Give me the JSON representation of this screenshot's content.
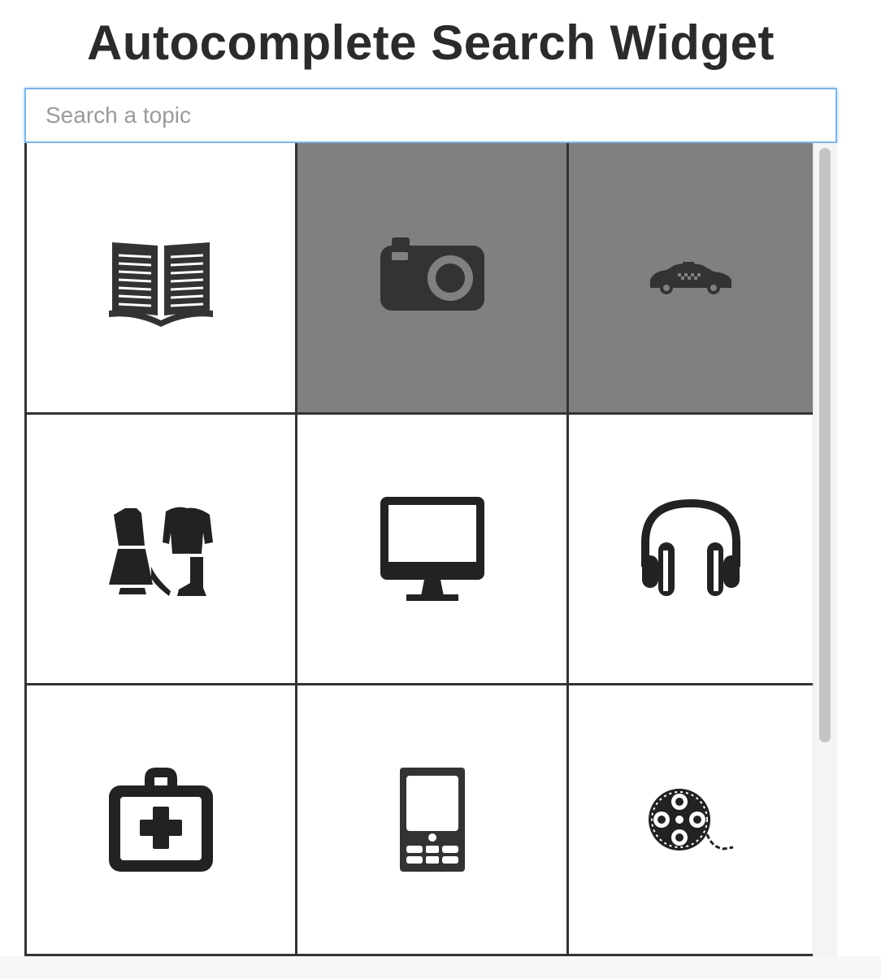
{
  "header": {
    "title": "Autocomplete Search Widget"
  },
  "search": {
    "placeholder": "Search a topic",
    "value": ""
  },
  "results": {
    "tiles": [
      {
        "label": "Books",
        "icon": "book-icon",
        "highlighted": false
      },
      {
        "label": "Cameras",
        "icon": "camera-icon",
        "highlighted": true
      },
      {
        "label": "Taxi",
        "icon": "taxi-icon",
        "highlighted": true
      },
      {
        "label": "Clothing",
        "icon": "clothing-icon",
        "highlighted": false
      },
      {
        "label": "Computers",
        "icon": "monitor-icon",
        "highlighted": false
      },
      {
        "label": "Headphones",
        "icon": "headphones-icon",
        "highlighted": false
      },
      {
        "label": "Medical",
        "icon": "first-aid-kit-icon",
        "highlighted": false
      },
      {
        "label": "Mobile Phones",
        "icon": "mobile-phone-icon",
        "highlighted": false
      },
      {
        "label": "Movies",
        "icon": "film-reel-icon",
        "highlighted": false
      }
    ],
    "scroll_position": 0,
    "visible_fraction": 0.74
  },
  "colors": {
    "highlight": "#808080",
    "icon": "#333333",
    "border": "#333333",
    "input_focus": "#7fb4e6"
  }
}
